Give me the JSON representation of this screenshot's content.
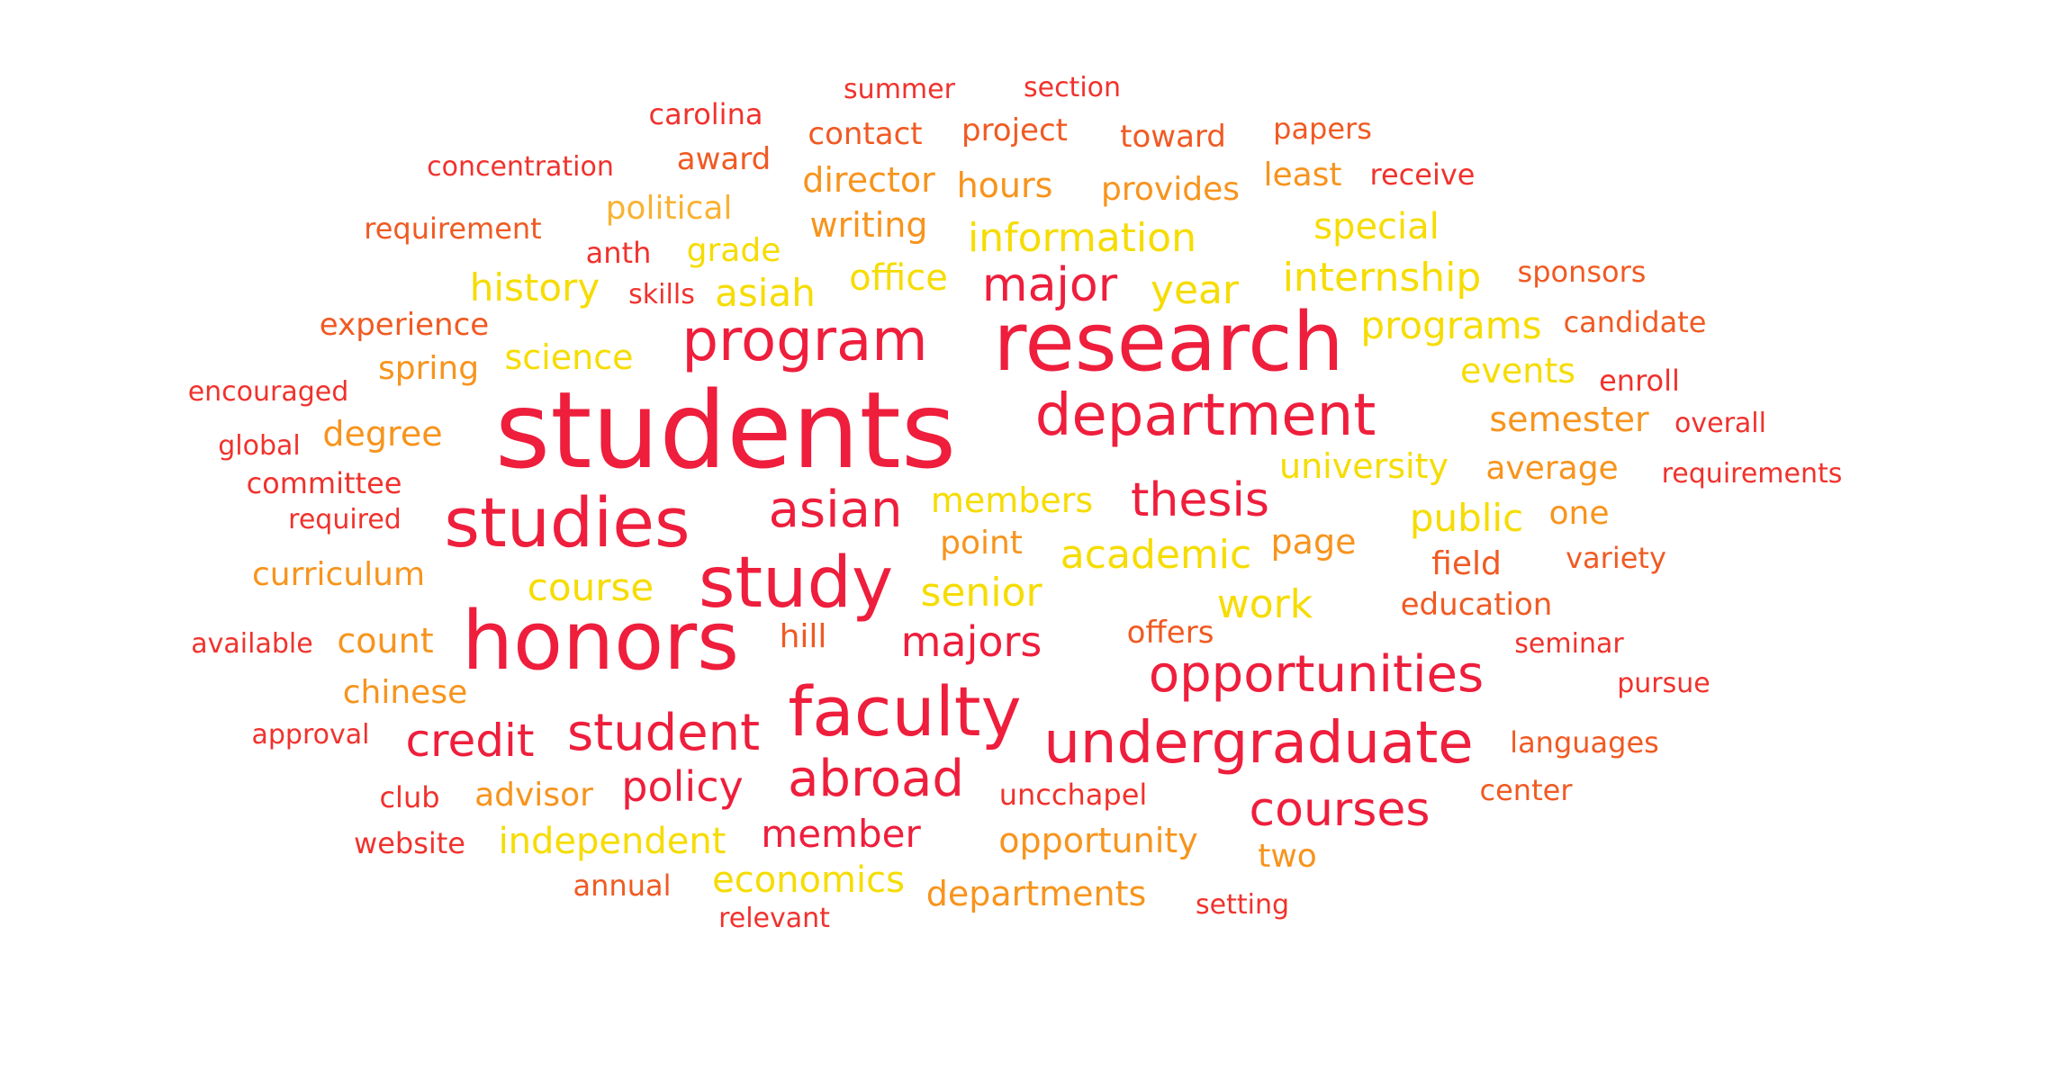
{
  "palette": {
    "crimson": "#ee1e3c",
    "red": "#f0322d",
    "orange_red": "#f05a23",
    "orange": "#f7941d",
    "amber": "#f9b233",
    "yellow": "#f6dc00"
  },
  "words": [
    {
      "id": "students",
      "text": "students",
      "color": "crimson"
    },
    {
      "id": "research",
      "text": "research",
      "color": "crimson"
    },
    {
      "id": "honors",
      "text": "honors",
      "color": "crimson"
    },
    {
      "id": "studies",
      "text": "studies",
      "color": "crimson"
    },
    {
      "id": "study",
      "text": "study",
      "color": "crimson"
    },
    {
      "id": "faculty",
      "text": "faculty",
      "color": "crimson"
    },
    {
      "id": "program",
      "text": "program",
      "color": "crimson"
    },
    {
      "id": "department",
      "text": "department",
      "color": "crimson"
    },
    {
      "id": "undergraduate",
      "text": "undergraduate",
      "color": "crimson"
    },
    {
      "id": "opportunities",
      "text": "opportunities",
      "color": "crimson"
    },
    {
      "id": "student",
      "text": "student",
      "color": "crimson"
    },
    {
      "id": "abroad",
      "text": "abroad",
      "color": "crimson"
    },
    {
      "id": "asian",
      "text": "asian",
      "color": "crimson"
    },
    {
      "id": "thesis",
      "text": "thesis",
      "color": "crimson"
    },
    {
      "id": "major",
      "text": "major",
      "color": "crimson"
    },
    {
      "id": "courses",
      "text": "courses",
      "color": "crimson"
    },
    {
      "id": "credit",
      "text": "credit",
      "color": "crimson"
    },
    {
      "id": "policy",
      "text": "policy",
      "color": "crimson"
    },
    {
      "id": "member",
      "text": "member",
      "color": "crimson"
    },
    {
      "id": "majors",
      "text": "majors",
      "color": "crimson"
    },
    {
      "id": "summer",
      "text": "summer",
      "color": "red"
    },
    {
      "id": "section",
      "text": "section",
      "color": "red"
    },
    {
      "id": "carolina",
      "text": "carolina",
      "color": "red"
    },
    {
      "id": "concentration",
      "text": "concentration",
      "color": "red"
    },
    {
      "id": "receive",
      "text": "receive",
      "color": "red"
    },
    {
      "id": "skills",
      "text": "skills",
      "color": "red"
    },
    {
      "id": "encouraged",
      "text": "encouraged",
      "color": "red"
    },
    {
      "id": "enroll",
      "text": "enroll",
      "color": "red"
    },
    {
      "id": "overall",
      "text": "overall",
      "color": "red"
    },
    {
      "id": "global",
      "text": "global",
      "color": "red"
    },
    {
      "id": "committee",
      "text": "committee",
      "color": "red"
    },
    {
      "id": "requirements",
      "text": "requirements",
      "color": "red"
    },
    {
      "id": "required",
      "text": "required",
      "color": "red"
    },
    {
      "id": "available",
      "text": "available",
      "color": "red"
    },
    {
      "id": "pursue",
      "text": "pursue",
      "color": "red"
    },
    {
      "id": "approval",
      "text": "approval",
      "color": "red"
    },
    {
      "id": "website",
      "text": "website",
      "color": "red"
    },
    {
      "id": "relevant",
      "text": "relevant",
      "color": "red"
    },
    {
      "id": "setting",
      "text": "setting",
      "color": "red"
    },
    {
      "id": "club",
      "text": "club",
      "color": "red"
    },
    {
      "id": "unc-chapel",
      "text": "uncchapel",
      "color": "red"
    },
    {
      "id": "seminar",
      "text": "seminar",
      "color": "red"
    },
    {
      "id": "anth",
      "text": "anth",
      "color": "red"
    },
    {
      "id": "contact",
      "text": "contact",
      "color": "orange_red"
    },
    {
      "id": "project",
      "text": "project",
      "color": "orange_red"
    },
    {
      "id": "toward",
      "text": "toward",
      "color": "orange_red"
    },
    {
      "id": "papers",
      "text": "papers",
      "color": "orange_red"
    },
    {
      "id": "award",
      "text": "award",
      "color": "orange_red"
    },
    {
      "id": "requirement",
      "text": "requirement",
      "color": "orange_red"
    },
    {
      "id": "sponsors",
      "text": "sponsors",
      "color": "orange_red"
    },
    {
      "id": "experience",
      "text": "experience",
      "color": "orange_red"
    },
    {
      "id": "candidate",
      "text": "candidate",
      "color": "orange_red"
    },
    {
      "id": "field",
      "text": "field",
      "color": "orange_red"
    },
    {
      "id": "variety",
      "text": "variety",
      "color": "orange_red"
    },
    {
      "id": "education",
      "text": "education",
      "color": "orange_red"
    },
    {
      "id": "hill",
      "text": "hill",
      "color": "orange_red"
    },
    {
      "id": "offers",
      "text": "offers",
      "color": "orange_red"
    },
    {
      "id": "languages",
      "text": "languages",
      "color": "orange_red"
    },
    {
      "id": "center",
      "text": "center",
      "color": "orange_red"
    },
    {
      "id": "annual",
      "text": "annual",
      "color": "orange_red"
    },
    {
      "id": "director",
      "text": "director",
      "color": "orange"
    },
    {
      "id": "hours",
      "text": "hours",
      "color": "orange"
    },
    {
      "id": "provides",
      "text": "provides",
      "color": "orange"
    },
    {
      "id": "least",
      "text": "least",
      "color": "orange"
    },
    {
      "id": "writing",
      "text": "writing",
      "color": "orange"
    },
    {
      "id": "spring",
      "text": "spring",
      "color": "orange"
    },
    {
      "id": "degree",
      "text": "degree",
      "color": "orange"
    },
    {
      "id": "semester",
      "text": "semester",
      "color": "orange"
    },
    {
      "id": "average",
      "text": "average",
      "color": "orange"
    },
    {
      "id": "curriculum",
      "text": "curriculum",
      "color": "orange"
    },
    {
      "id": "one",
      "text": "one",
      "color": "orange"
    },
    {
      "id": "count",
      "text": "count",
      "color": "orange"
    },
    {
      "id": "chinese",
      "text": "chinese",
      "color": "orange"
    },
    {
      "id": "advisor",
      "text": "advisor",
      "color": "orange"
    },
    {
      "id": "opportunity",
      "text": "opportunity",
      "color": "orange"
    },
    {
      "id": "departments",
      "text": "departments",
      "color": "orange"
    },
    {
      "id": "two",
      "text": "two",
      "color": "orange"
    },
    {
      "id": "page",
      "text": "page",
      "color": "orange"
    },
    {
      "id": "point",
      "text": "point",
      "color": "orange"
    },
    {
      "id": "political",
      "text": "political",
      "color": "amber"
    },
    {
      "id": "grade",
      "text": "grade",
      "color": "yellow"
    },
    {
      "id": "information",
      "text": "information",
      "color": "yellow"
    },
    {
      "id": "special",
      "text": "special",
      "color": "yellow"
    },
    {
      "id": "history",
      "text": "history",
      "color": "yellow"
    },
    {
      "id": "asiah",
      "text": "asiah",
      "color": "yellow"
    },
    {
      "id": "office",
      "text": "office",
      "color": "yellow"
    },
    {
      "id": "year",
      "text": "year",
      "color": "yellow"
    },
    {
      "id": "internship",
      "text": "internship",
      "color": "yellow"
    },
    {
      "id": "programs",
      "text": "programs",
      "color": "yellow"
    },
    {
      "id": "science",
      "text": "science",
      "color": "yellow"
    },
    {
      "id": "events",
      "text": "events",
      "color": "yellow"
    },
    {
      "id": "university",
      "text": "university",
      "color": "yellow"
    },
    {
      "id": "members",
      "text": "members",
      "color": "yellow"
    },
    {
      "id": "public",
      "text": "public",
      "color": "yellow"
    },
    {
      "id": "academic",
      "text": "academic",
      "color": "yellow"
    },
    {
      "id": "course",
      "text": "course",
      "color": "yellow"
    },
    {
      "id": "senior",
      "text": "senior",
      "color": "yellow"
    },
    {
      "id": "work",
      "text": "work",
      "color": "yellow"
    },
    {
      "id": "independent",
      "text": "independent",
      "color": "yellow"
    },
    {
      "id": "economics",
      "text": "economics",
      "color": "yellow"
    }
  ]
}
